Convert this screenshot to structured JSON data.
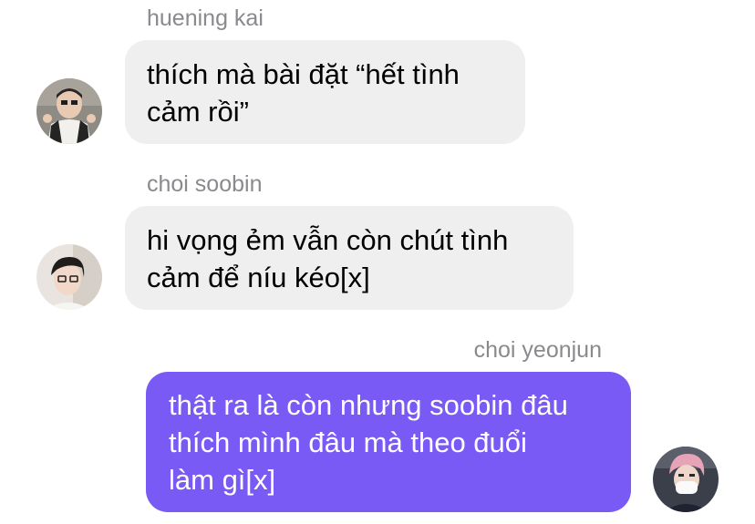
{
  "messages": [
    {
      "sender": "huening kai",
      "direction": "incoming",
      "lines": [
        "thích mà bài đặt “hết tình",
        "cảm rồi”"
      ],
      "avatar_icon": "profile-photo-icon"
    },
    {
      "sender": "choi soobin",
      "direction": "incoming",
      "lines": [
        "hi vọng ẻm vẫn còn chút tình",
        "cảm để níu kéo[x]"
      ],
      "avatar_icon": "profile-photo-icon"
    },
    {
      "sender": "choi yeonjun",
      "direction": "outgoing",
      "lines": [
        "thật ra là còn nhưng soobin đâu",
        "thích mình đâu mà theo đuổi",
        "làm gì[x]"
      ],
      "avatar_icon": "profile-photo-icon"
    }
  ],
  "colors": {
    "incoming_bubble": "#efeff0",
    "outgoing_bubble": "#7a5af5",
    "sender_name": "#8a8a8e"
  }
}
